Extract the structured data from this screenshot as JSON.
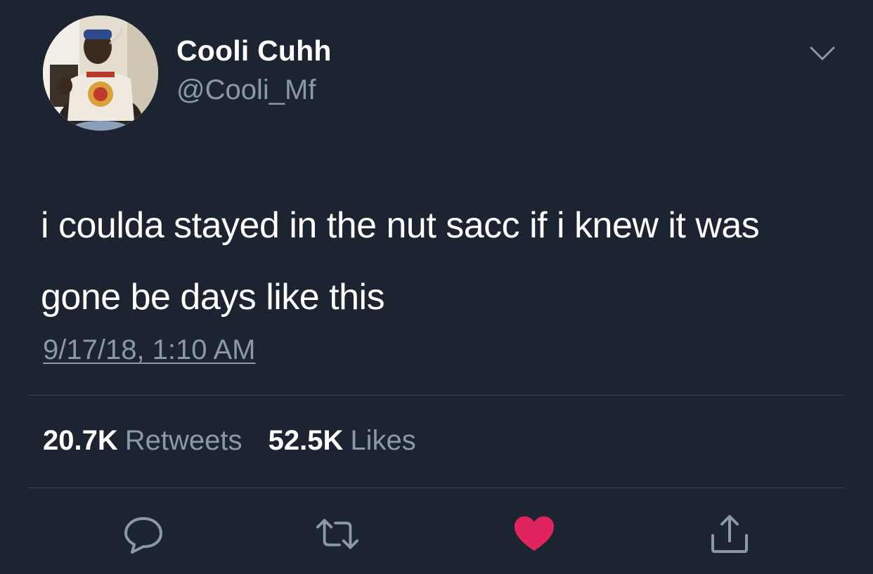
{
  "user": {
    "display_name": "Cooli Cuhh",
    "handle": "@Cooli_Mf",
    "avatar_icon": "profile-photo"
  },
  "tweet": {
    "text": "i coulda stayed in the nut sacc if i knew it was gone be days like this",
    "timestamp": "9/17/18, 1:10 AM"
  },
  "stats": {
    "retweets_count": "20.7K",
    "retweets_label": "Retweets",
    "likes_count": "52.5K",
    "likes_label": "Likes"
  },
  "actions": {
    "reply_icon": "speech-bubble-icon",
    "retweet_icon": "retweet-arrows-icon",
    "like_icon": "heart-icon",
    "share_icon": "share-upload-icon",
    "liked": true
  },
  "colors": {
    "background": "#1c2331",
    "primary_text": "#ffffff",
    "secondary_text": "#8b98a5",
    "divider": "#3d4654",
    "like_active": "#e0245e"
  }
}
